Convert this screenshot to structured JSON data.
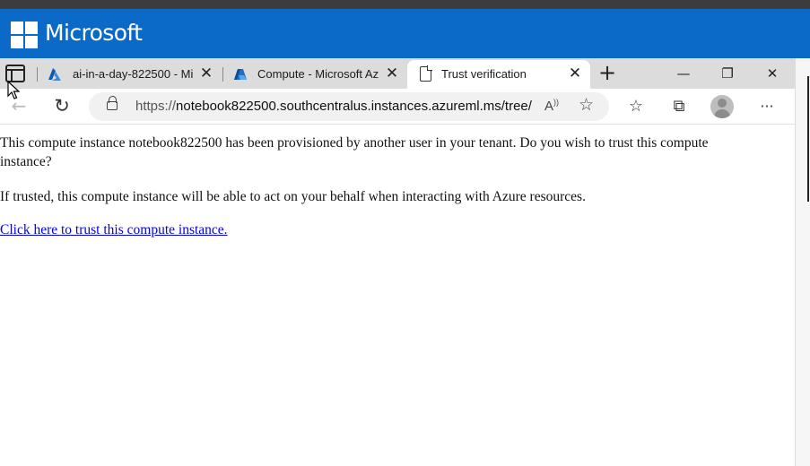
{
  "banner": {
    "brand": "Microsoft"
  },
  "browser": {
    "tabs": [
      {
        "title": "ai-in-a-day-822500 - Mi",
        "favicon": "azure-icon"
      },
      {
        "title": "Compute - Microsoft Az",
        "favicon": "azureml-icon"
      },
      {
        "title": "Trust verification",
        "favicon": "page-icon",
        "active": true
      }
    ],
    "new_tab_label": "+",
    "window_controls": {
      "minimize": "—",
      "restore": "❐",
      "close": "✕"
    },
    "address": {
      "protocol": "https://",
      "host_and_path": "notebook822500.southcentralus.instances.azureml.ms/tree/"
    },
    "read_aloud_label": "A",
    "more_label": "···"
  },
  "page": {
    "paragraph1": "This compute instance notebook822500 has been provisioned by another user in your tenant. Do you wish to trust this compute instance?",
    "paragraph2": "If trusted, this compute instance will be able to act on your behalf when interacting with Azure resources.",
    "trust_link": "Click here to trust this compute instance."
  },
  "colors": {
    "banner": "#0b6ac7",
    "tabstrip": "#dcdcdc",
    "link": "#0000ee"
  }
}
